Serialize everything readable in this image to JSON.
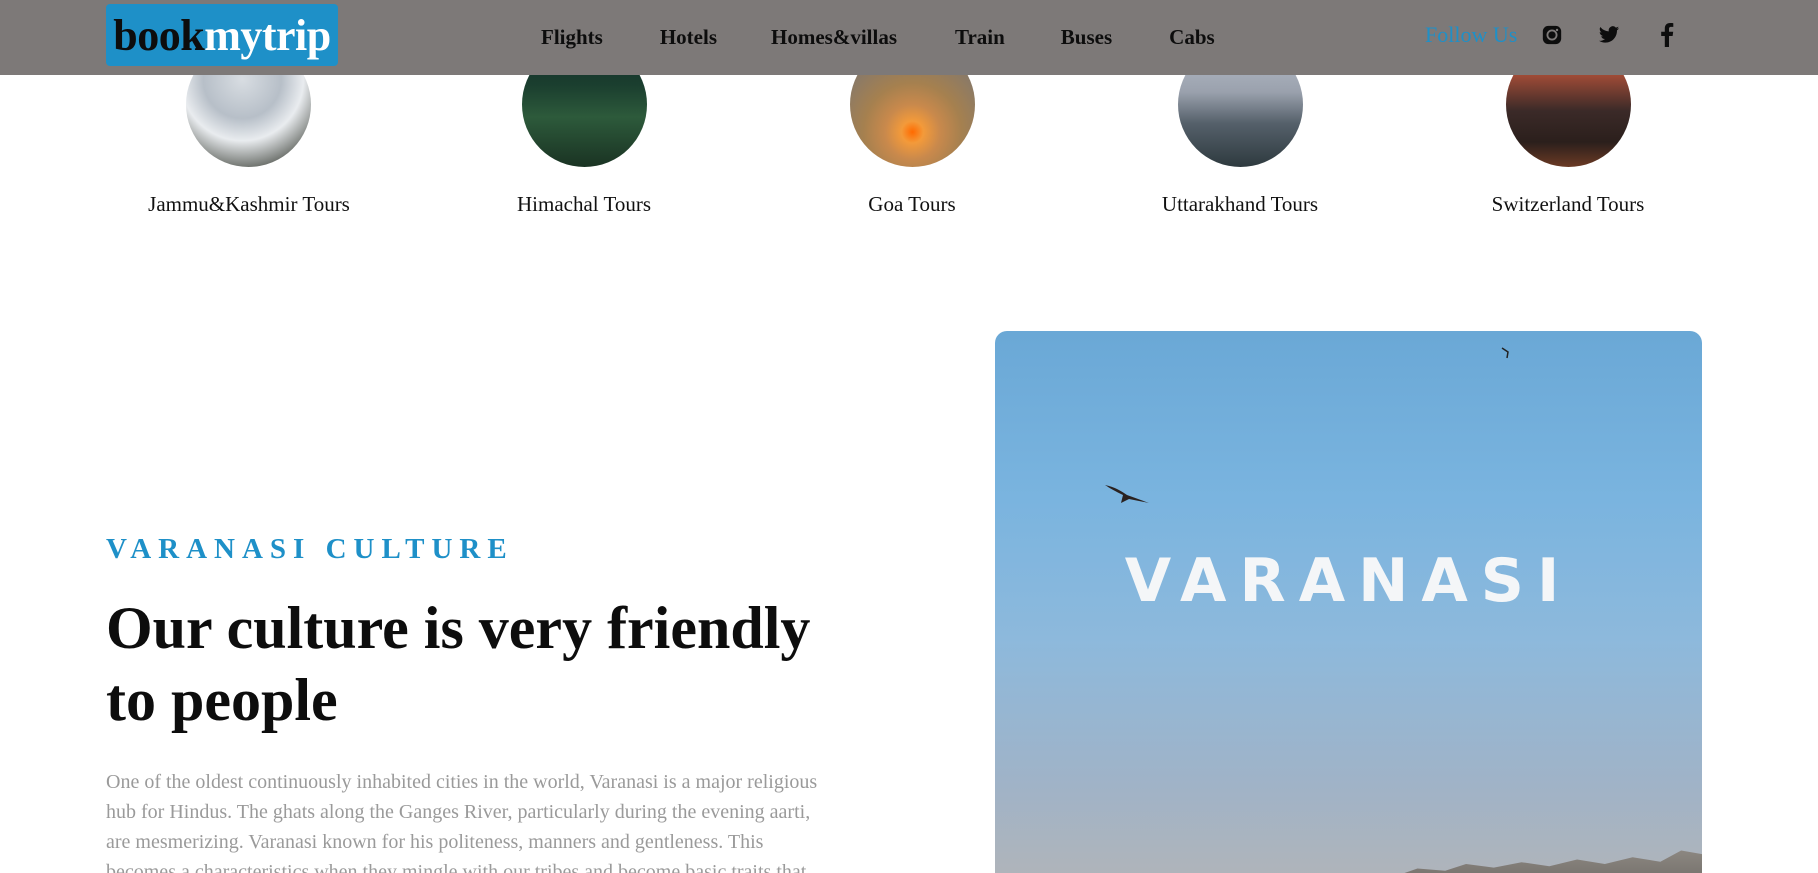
{
  "brand": {
    "part1": "book",
    "part2": "mytrip"
  },
  "nav": {
    "items": [
      {
        "label": "Flights"
      },
      {
        "label": "Hotels"
      },
      {
        "label": "Homes&villas"
      },
      {
        "label": "Train"
      },
      {
        "label": "Buses"
      },
      {
        "label": "Cabs"
      }
    ]
  },
  "social": {
    "follow_label": "Follow Us",
    "icons": [
      "instagram-icon",
      "twitter-icon",
      "facebook-icon"
    ]
  },
  "tours": [
    {
      "label": "Jammu&Kashmir Tours"
    },
    {
      "label": "Himachal Tours"
    },
    {
      "label": "Goa Tours"
    },
    {
      "label": "Uttarakhand Tours"
    },
    {
      "label": "Switzerland Tours"
    }
  ],
  "culture": {
    "eyebrow": "VARANASI CULTURE",
    "headline": "Our culture is very friendly to people",
    "body": "One of the oldest continuously inhabited cities in the world, Varanasi is a major religious hub for Hindus. The ghats along the Ganges River, particularly during the evening aarti, are mesmerizing. Varanasi known for his politeness, manners and gentleness. This becomes a characteristics when they mingle with our tribes and become basic traits that"
  },
  "hero": {
    "title": "VARANASI"
  },
  "colors": {
    "accent": "#1e90c8",
    "header_bg": "#7d7978"
  }
}
